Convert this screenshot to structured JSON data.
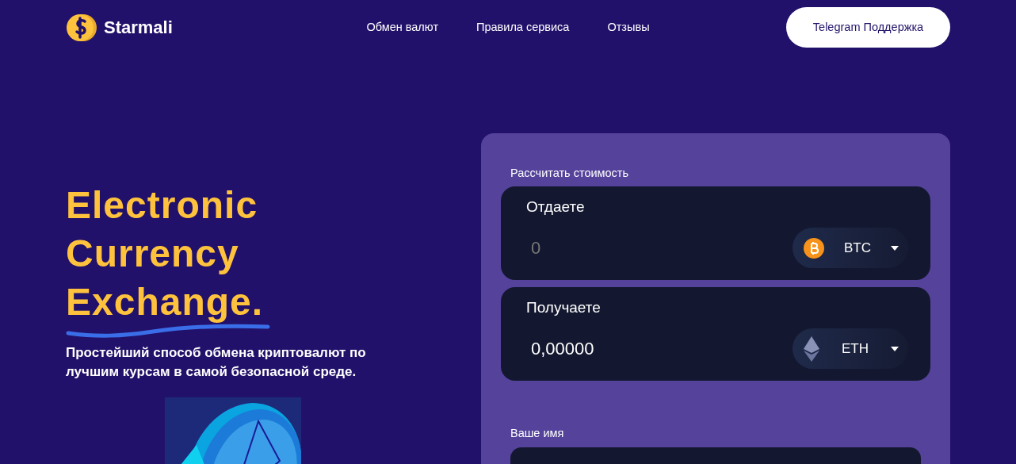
{
  "brand": {
    "name": "Starmali"
  },
  "nav": [
    {
      "label": "Обмен валют"
    },
    {
      "label": "Правила сервиса"
    },
    {
      "label": "Отзывы"
    }
  ],
  "support_button": {
    "label": "Telegram Поддержка"
  },
  "hero": {
    "title_lines": [
      "Electronic",
      "Currency",
      "Exchange."
    ],
    "subtitle": "Простейший способ обмена криптовалют по лучшим курсам в самой безопасной среде."
  },
  "calculator": {
    "title": "Рассчитать стоимость",
    "rows": [
      {
        "label": "Отдаете",
        "placeholder": "0",
        "currency": "BTC",
        "kind": "btc"
      },
      {
        "label": "Получаете",
        "value": "0,00000",
        "currency": "ETH",
        "kind": "eth"
      }
    ],
    "name_field": {
      "label": "Ваше имя"
    }
  }
}
